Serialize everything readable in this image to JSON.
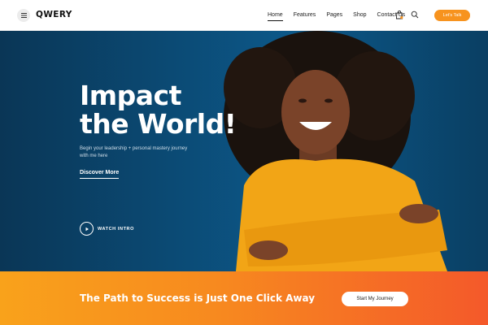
{
  "header": {
    "logo": "QWERY",
    "nav": [
      "Home",
      "Features",
      "Pages",
      "Shop",
      "Contact Us"
    ],
    "active_nav": "Home",
    "cta_label": "Let's Talk",
    "icons": {
      "menu": "hamburger-icon",
      "bag": "shopping-bag-icon",
      "search": "search-icon"
    }
  },
  "hero": {
    "title_line1": "Impact",
    "title_line2": "the World!",
    "subtitle": "Begin your leadership + personal mastery journey with me here",
    "discover_label": "Discover More",
    "watch_label": "WATCH INTRO"
  },
  "banner": {
    "text": "The Path to Success is Just One Click Away",
    "button_label": "Start My Journey"
  },
  "colors": {
    "accent": "#f7931e",
    "hero_bg": "#0b4a74",
    "banner_start": "#f9a21b",
    "banner_end": "#f4592a"
  }
}
